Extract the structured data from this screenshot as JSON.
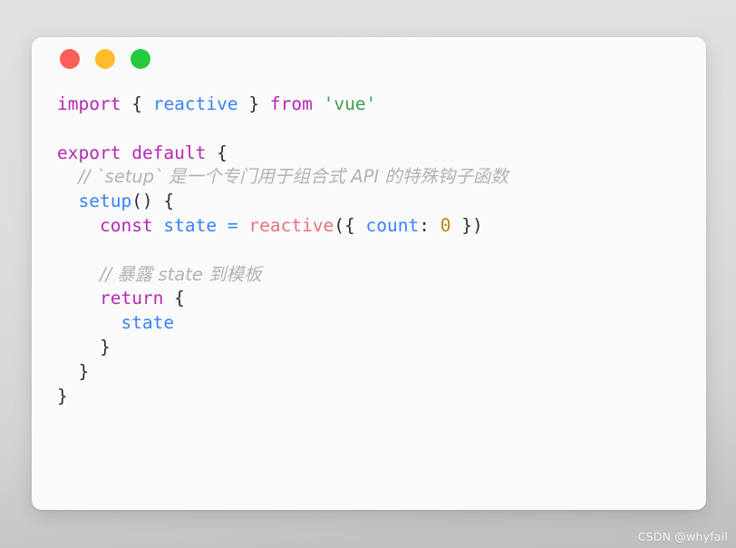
{
  "window": {
    "controls": [
      {
        "name": "close",
        "color": "#ff5f56"
      },
      {
        "name": "minimize",
        "color": "#ffbd2e"
      },
      {
        "name": "maximize",
        "color": "#27c93f"
      }
    ]
  },
  "theme": {
    "background_top": "#e0e0e0",
    "background_bottom": "#bdbdbd",
    "card_background": "#fafafa",
    "keyword": "#b429b4",
    "identifier": "#3b82f6",
    "function": "#e8727c",
    "string": "#3f9e55",
    "number": "#b8860b",
    "punctuation": "#2b2f38",
    "comment": "#b0b3bb"
  },
  "code": {
    "language": "javascript",
    "lines": [
      {
        "n": 1,
        "indent": "",
        "tokens": [
          {
            "t": "import",
            "c": "kw"
          },
          {
            "t": " ",
            "c": "punc"
          },
          {
            "t": "{",
            "c": "punc"
          },
          {
            "t": " ",
            "c": "punc"
          },
          {
            "t": "reactive",
            "c": "ident"
          },
          {
            "t": " ",
            "c": "punc"
          },
          {
            "t": "}",
            "c": "punc"
          },
          {
            "t": " ",
            "c": "punc"
          },
          {
            "t": "from",
            "c": "kw"
          },
          {
            "t": " ",
            "c": "punc"
          },
          {
            "t": "'vue'",
            "c": "str"
          }
        ]
      },
      {
        "n": 2,
        "indent": "",
        "tokens": []
      },
      {
        "n": 3,
        "indent": "",
        "tokens": [
          {
            "t": "export",
            "c": "kw"
          },
          {
            "t": " ",
            "c": "punc"
          },
          {
            "t": "default",
            "c": "kw"
          },
          {
            "t": " ",
            "c": "punc"
          },
          {
            "t": "{",
            "c": "punc"
          }
        ]
      },
      {
        "n": 4,
        "indent": "  ",
        "tokens": [
          {
            "t": "// `setup` 是一个专门用于组合式 API 的特殊钩子函数",
            "c": "cmt"
          }
        ]
      },
      {
        "n": 5,
        "indent": "  ",
        "tokens": [
          {
            "t": "setup",
            "c": "ident"
          },
          {
            "t": "()",
            "c": "punc"
          },
          {
            "t": " ",
            "c": "punc"
          },
          {
            "t": "{",
            "c": "punc"
          }
        ]
      },
      {
        "n": 6,
        "indent": "    ",
        "tokens": [
          {
            "t": "const",
            "c": "kw"
          },
          {
            "t": " ",
            "c": "punc"
          },
          {
            "t": "state",
            "c": "ident"
          },
          {
            "t": " ",
            "c": "punc"
          },
          {
            "t": "=",
            "c": "op"
          },
          {
            "t": " ",
            "c": "punc"
          },
          {
            "t": "reactive",
            "c": "fn"
          },
          {
            "t": "({",
            "c": "punc"
          },
          {
            "t": " ",
            "c": "punc"
          },
          {
            "t": "count",
            "c": "ident"
          },
          {
            "t": ":",
            "c": "punc"
          },
          {
            "t": " ",
            "c": "punc"
          },
          {
            "t": "0",
            "c": "num"
          },
          {
            "t": " ",
            "c": "punc"
          },
          {
            "t": "})",
            "c": "punc"
          }
        ]
      },
      {
        "n": 7,
        "indent": "",
        "tokens": []
      },
      {
        "n": 8,
        "indent": "    ",
        "tokens": [
          {
            "t": "// 暴露 state 到模板",
            "c": "cmt"
          }
        ]
      },
      {
        "n": 9,
        "indent": "    ",
        "tokens": [
          {
            "t": "return",
            "c": "kw"
          },
          {
            "t": " ",
            "c": "punc"
          },
          {
            "t": "{",
            "c": "punc"
          }
        ]
      },
      {
        "n": 10,
        "indent": "      ",
        "tokens": [
          {
            "t": "state",
            "c": "ident"
          }
        ]
      },
      {
        "n": 11,
        "indent": "    ",
        "tokens": [
          {
            "t": "}",
            "c": "punc"
          }
        ]
      },
      {
        "n": 12,
        "indent": "  ",
        "tokens": [
          {
            "t": "}",
            "c": "punc"
          }
        ]
      },
      {
        "n": 13,
        "indent": "",
        "tokens": [
          {
            "t": "}",
            "c": "punc"
          }
        ]
      }
    ]
  },
  "watermark": {
    "text": "CSDN @whyfail"
  }
}
